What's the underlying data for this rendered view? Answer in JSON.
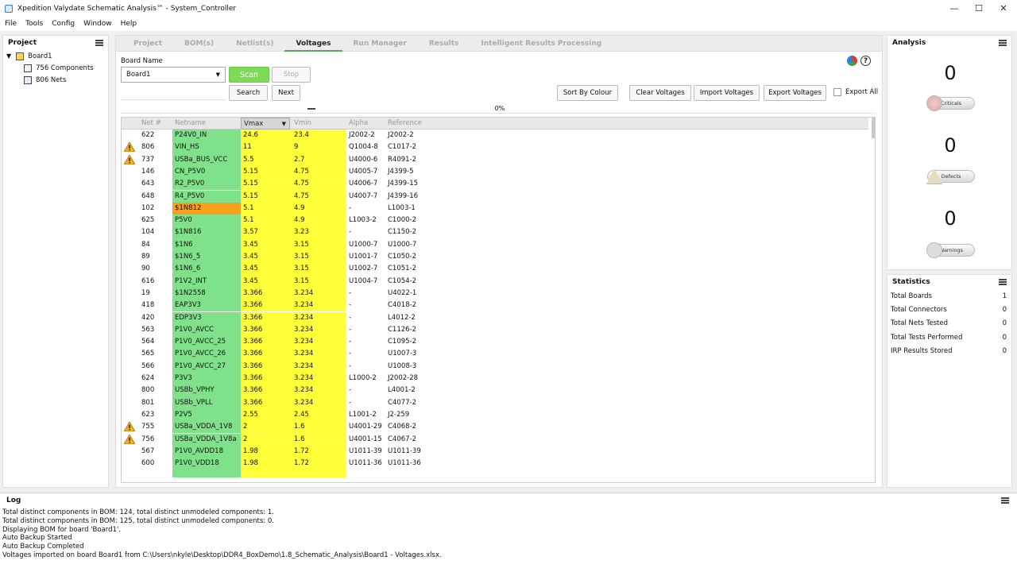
{
  "window": {
    "title": "Xpedition Valydate Schematic Analysis™ - System_Controller",
    "minimize": "—",
    "maximize": "☐",
    "close": "✕"
  },
  "menu": [
    "File",
    "Tools",
    "Config",
    "Window",
    "Help"
  ],
  "project": {
    "title": "Project",
    "board": "Board1",
    "components": "756 Components",
    "nets": "806 Nets"
  },
  "tabs": [
    "Project",
    "BOM(s)",
    "Netlist(s)",
    "Voltages",
    "Run Manager",
    "Results",
    "Intelligent Results Processing"
  ],
  "active_tab": "Voltages",
  "toolbar": {
    "board_name_label": "Board Name",
    "board_select": "Board1",
    "scan": "Scan",
    "stop": "Stop",
    "search": "Search",
    "next": "Next",
    "sort_by_colour": "Sort By Colour",
    "clear_voltages": "Clear Voltages",
    "import_voltages": "Import Voltages",
    "export_voltages": "Export Voltages",
    "export_all": "Export All",
    "progress": "0%"
  },
  "grid": {
    "headers": [
      "Net #",
      "Netname",
      "Vmax",
      "Vmin",
      "Alpha",
      "Reference"
    ],
    "rows": [
      {
        "warn": false,
        "net": "622",
        "name": "P24V0_IN",
        "vmax": "24.6",
        "vmin": "23.4",
        "alpha": "J2002-2",
        "ref": "J2002-2"
      },
      {
        "warn": true,
        "net": "806",
        "name": "VIN_HS",
        "vmax": "11",
        "vmin": "9",
        "alpha": "Q1004-8",
        "ref": "C1017-2"
      },
      {
        "warn": true,
        "net": "737",
        "name": "USBa_BUS_VCC",
        "vmax": "5.5",
        "vmin": "2.7",
        "alpha": "U4000-6",
        "ref": "R4091-2"
      },
      {
        "warn": false,
        "net": "146",
        "name": "CN_P5V0",
        "vmax": "5.15",
        "vmin": "4.75",
        "alpha": "U4005-7",
        "ref": "J4399-5"
      },
      {
        "warn": false,
        "net": "643",
        "name": "R2_P5V0",
        "vmax": "5.15",
        "vmin": "4.75",
        "alpha": "U4006-7",
        "ref": "J4399-15"
      },
      {
        "warn": false,
        "net": "648",
        "name": "R4_P5V0",
        "vmax": "5.15",
        "vmin": "4.75",
        "alpha": "U4007-7",
        "ref": "J4399-16"
      },
      {
        "warn": false,
        "orange": true,
        "net": "102",
        "name": "$1N812",
        "vmax": "5.1",
        "vmin": "4.9",
        "alpha": "-",
        "ref": "L1003-1"
      },
      {
        "warn": false,
        "net": "625",
        "name": "P5V0",
        "vmax": "5.1",
        "vmin": "4.9",
        "alpha": "L1003-2",
        "ref": "C1000-2"
      },
      {
        "warn": false,
        "net": "104",
        "name": "$1N816",
        "vmax": "3.57",
        "vmin": "3.23",
        "alpha": "-",
        "ref": "C1150-2"
      },
      {
        "warn": false,
        "net": "84",
        "name": "$1N6",
        "vmax": "3.45",
        "vmin": "3.15",
        "alpha": "U1000-7",
        "ref": "U1000-7"
      },
      {
        "warn": false,
        "net": "89",
        "name": "$1N6_5",
        "vmax": "3.45",
        "vmin": "3.15",
        "alpha": "U1001-7",
        "ref": "C1050-2"
      },
      {
        "warn": false,
        "net": "90",
        "name": "$1N6_6",
        "vmax": "3.45",
        "vmin": "3.15",
        "alpha": "U1002-7",
        "ref": "C1051-2"
      },
      {
        "warn": false,
        "net": "616",
        "name": "P1V2_INT",
        "vmax": "3.45",
        "vmin": "3.15",
        "alpha": "U1004-7",
        "ref": "C1054-2"
      },
      {
        "warn": false,
        "net": "19",
        "name": "$1N2558",
        "vmax": "3.366",
        "vmin": "3.234",
        "alpha": "-",
        "ref": "U4022-1"
      },
      {
        "warn": false,
        "net": "418",
        "name": "EAP3V3",
        "vmax": "3.366",
        "vmin": "3.234",
        "alpha": "-",
        "ref": "C4018-2"
      },
      {
        "warn": false,
        "net": "420",
        "name": "EDP3V3",
        "vmax": "3.366",
        "vmin": "3.234",
        "alpha": "-",
        "ref": "L4012-2"
      },
      {
        "warn": false,
        "net": "563",
        "name": "P1V0_AVCC",
        "vmax": "3.366",
        "vmin": "3.234",
        "alpha": "-",
        "ref": "C1126-2"
      },
      {
        "warn": false,
        "net": "564",
        "name": "P1V0_AVCC_25",
        "vmax": "3.366",
        "vmin": "3.234",
        "alpha": "-",
        "ref": "C1095-2"
      },
      {
        "warn": false,
        "net": "565",
        "name": "P1V0_AVCC_26",
        "vmax": "3.366",
        "vmin": "3.234",
        "alpha": "-",
        "ref": "U1007-3"
      },
      {
        "warn": false,
        "net": "566",
        "name": "P1V0_AVCC_27",
        "vmax": "3.366",
        "vmin": "3.234",
        "alpha": "-",
        "ref": "U1008-3"
      },
      {
        "warn": false,
        "net": "624",
        "name": "P3V3",
        "vmax": "3.366",
        "vmin": "3.234",
        "alpha": "L1000-2",
        "ref": "J2002-28"
      },
      {
        "warn": false,
        "net": "800",
        "name": "USBb_VPHY",
        "vmax": "3.366",
        "vmin": "3.234",
        "alpha": "-",
        "ref": "L4001-2"
      },
      {
        "warn": false,
        "net": "801",
        "name": "USBb_VPLL",
        "vmax": "3.366",
        "vmin": "3.234",
        "alpha": "-",
        "ref": "C4077-2"
      },
      {
        "warn": false,
        "net": "623",
        "name": "P2V5",
        "vmax": "2.55",
        "vmin": "2.45",
        "alpha": "L1001-2",
        "ref": "J2-259"
      },
      {
        "warn": true,
        "net": "755",
        "name": "USBa_VDDA_1V8",
        "vmax": "2",
        "vmin": "1.6",
        "alpha": "U4001-29",
        "ref": "C4068-2"
      },
      {
        "warn": true,
        "net": "756",
        "name": "USBa_VDDA_1V8a",
        "vmax": "2",
        "vmin": "1.6",
        "alpha": "U4001-15",
        "ref": "C4067-2"
      },
      {
        "warn": false,
        "net": "567",
        "name": "P1V0_AVDD18",
        "vmax": "1.98",
        "vmin": "1.72",
        "alpha": "U1011-39",
        "ref": "U1011-39"
      },
      {
        "warn": false,
        "net": "600",
        "name": "P1V0_VDD18",
        "vmax": "1.98",
        "vmin": "1.72",
        "alpha": "U1011-36",
        "ref": "U1011-36"
      }
    ]
  },
  "analysis": {
    "title": "Analysis",
    "criticals_count": "0",
    "criticals_label": "Criticals",
    "defects_count": "0",
    "defects_label": "Defects",
    "warnings_count": "0",
    "warnings_label": "Warnings"
  },
  "statistics": {
    "title": "Statistics",
    "rows": [
      {
        "label": "Total Boards",
        "value": "1"
      },
      {
        "label": "Total Connectors",
        "value": "0"
      },
      {
        "label": "Total Nets Tested",
        "value": "0"
      },
      {
        "label": "Total Tests Performed",
        "value": "0"
      },
      {
        "label": "IRP Results Stored",
        "value": "0"
      }
    ]
  },
  "log": {
    "title": "Log",
    "lines": [
      "Total distinct components in BOM: 124, total distinct unmodeled components: 1.",
      "Total distinct components in BOM: 125, total distinct unmodeled components: 0.",
      "Displaying BOM for board 'Board1'.",
      "Auto Backup Started",
      "Auto Backup Completed",
      "Voltages imported on board Board1 from C:\\Users\\nkyle\\Desktop\\DDR4_BoxDemo\\1.8_Schematic_Analysis\\Board1 - Voltages.xlsx."
    ]
  },
  "colors": {
    "green_cell": "#7fe28a",
    "yellow_cell": "#ffff3a",
    "orange_cell": "#f5a11c",
    "scan_green": "#7ed957"
  }
}
